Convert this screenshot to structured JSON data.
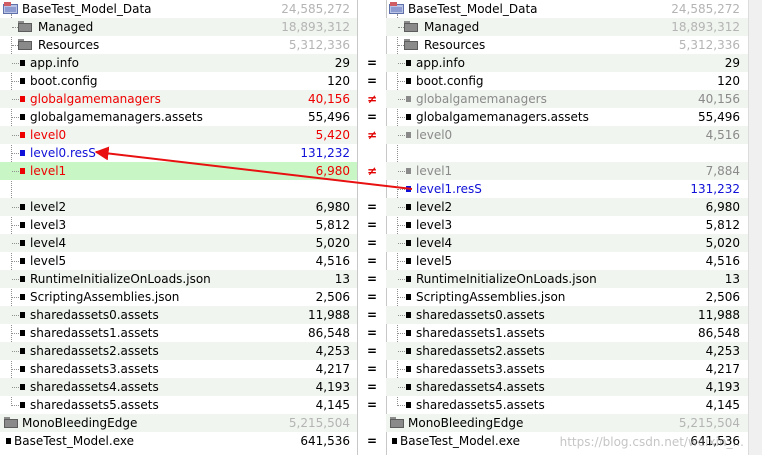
{
  "left": {
    "root": {
      "name": "BaseTest_Model_Data",
      "size": "24,585,272"
    },
    "rows": [
      {
        "name": "Managed",
        "size": "18,893,312",
        "kind": "folder",
        "status": "normal"
      },
      {
        "name": "Resources",
        "size": "5,312,336",
        "kind": "folder",
        "status": "normal"
      },
      {
        "name": "app.info",
        "size": "29",
        "kind": "file",
        "status": "normal"
      },
      {
        "name": "boot.config",
        "size": "120",
        "kind": "file",
        "status": "normal"
      },
      {
        "name": "globalgamemanagers",
        "size": "40,156",
        "kind": "file",
        "status": "red"
      },
      {
        "name": "globalgamemanagers.assets",
        "size": "55,496",
        "kind": "file",
        "status": "normal"
      },
      {
        "name": "level0",
        "size": "5,420",
        "kind": "file",
        "status": "red"
      },
      {
        "name": "level0.resS",
        "size": "131,232",
        "kind": "file",
        "status": "blue"
      },
      {
        "name": "level1",
        "size": "6,980",
        "kind": "file",
        "status": "red-green"
      },
      {
        "name": "",
        "size": "",
        "kind": "blank",
        "status": "normal"
      },
      {
        "name": "level2",
        "size": "6,980",
        "kind": "file",
        "status": "normal"
      },
      {
        "name": "level3",
        "size": "5,812",
        "kind": "file",
        "status": "normal"
      },
      {
        "name": "level4",
        "size": "5,020",
        "kind": "file",
        "status": "normal"
      },
      {
        "name": "level5",
        "size": "4,516",
        "kind": "file",
        "status": "normal"
      },
      {
        "name": "RuntimeInitializeOnLoads.json",
        "size": "13",
        "kind": "file",
        "status": "normal"
      },
      {
        "name": "ScriptingAssemblies.json",
        "size": "2,506",
        "kind": "file",
        "status": "normal"
      },
      {
        "name": "sharedassets0.assets",
        "size": "11,988",
        "kind": "file",
        "status": "normal"
      },
      {
        "name": "sharedassets1.assets",
        "size": "86,548",
        "kind": "file",
        "status": "normal"
      },
      {
        "name": "sharedassets2.assets",
        "size": "4,253",
        "kind": "file",
        "status": "normal"
      },
      {
        "name": "sharedassets3.assets",
        "size": "4,217",
        "kind": "file",
        "status": "normal"
      },
      {
        "name": "sharedassets4.assets",
        "size": "4,193",
        "kind": "file",
        "status": "normal"
      },
      {
        "name": "sharedassets5.assets",
        "size": "4,145",
        "kind": "file",
        "status": "normal"
      }
    ],
    "tail": [
      {
        "name": "MonoBleedingEdge",
        "size": "5,215,504",
        "kind": "topfolder"
      },
      {
        "name": "BaseTest_Model.exe",
        "size": "641,536",
        "kind": "topfile"
      }
    ]
  },
  "right": {
    "root": {
      "name": "BaseTest_Model_Data",
      "size": "24,585,272"
    },
    "rows": [
      {
        "name": "Managed",
        "size": "18,893,312",
        "kind": "folder",
        "status": "normal"
      },
      {
        "name": "Resources",
        "size": "5,312,336",
        "kind": "folder",
        "status": "normal"
      },
      {
        "name": "app.info",
        "size": "29",
        "kind": "file",
        "status": "normal"
      },
      {
        "name": "boot.config",
        "size": "120",
        "kind": "file",
        "status": "normal"
      },
      {
        "name": "globalgamemanagers",
        "size": "40,156",
        "kind": "file",
        "status": "gray"
      },
      {
        "name": "globalgamemanagers.assets",
        "size": "55,496",
        "kind": "file",
        "status": "normal"
      },
      {
        "name": "level0",
        "size": "4,516",
        "kind": "file",
        "status": "gray"
      },
      {
        "name": "",
        "size": "",
        "kind": "blank",
        "status": "normal"
      },
      {
        "name": "level1",
        "size": "7,884",
        "kind": "file",
        "status": "gray"
      },
      {
        "name": "level1.resS",
        "size": "131,232",
        "kind": "file",
        "status": "blue"
      },
      {
        "name": "level2",
        "size": "6,980",
        "kind": "file",
        "status": "normal"
      },
      {
        "name": "level3",
        "size": "5,812",
        "kind": "file",
        "status": "normal"
      },
      {
        "name": "level4",
        "size": "5,020",
        "kind": "file",
        "status": "normal"
      },
      {
        "name": "level5",
        "size": "4,516",
        "kind": "file",
        "status": "normal"
      },
      {
        "name": "RuntimeInitializeOnLoads.json",
        "size": "13",
        "kind": "file",
        "status": "normal"
      },
      {
        "name": "ScriptingAssemblies.json",
        "size": "2,506",
        "kind": "file",
        "status": "normal"
      },
      {
        "name": "sharedassets0.assets",
        "size": "11,988",
        "kind": "file",
        "status": "normal"
      },
      {
        "name": "sharedassets1.assets",
        "size": "86,548",
        "kind": "file",
        "status": "normal"
      },
      {
        "name": "sharedassets2.assets",
        "size": "4,253",
        "kind": "file",
        "status": "normal"
      },
      {
        "name": "sharedassets3.assets",
        "size": "4,217",
        "kind": "file",
        "status": "normal"
      },
      {
        "name": "sharedassets4.assets",
        "size": "4,193",
        "kind": "file",
        "status": "normal"
      },
      {
        "name": "sharedassets5.assets",
        "size": "4,145",
        "kind": "file",
        "status": "normal"
      }
    ],
    "tail": [
      {
        "name": "MonoBleedingEdge",
        "size": "5,215,504",
        "kind": "topfolder"
      },
      {
        "name": "BaseTest_Model.exe",
        "size": "641,536",
        "kind": "topfile"
      }
    ]
  },
  "compare_marks": [
    "",
    "",
    "",
    "=",
    "=",
    "≠",
    "=",
    "≠",
    "",
    "≠",
    "",
    "=",
    "=",
    "=",
    "=",
    "=",
    "=",
    "=",
    "=",
    "=",
    "=",
    "=",
    "=",
    "",
    "="
  ],
  "watermark": "https://blog.csdn.net/weixin_...",
  "colors": {
    "different": "#ee0000",
    "orphan": "#1010d8",
    "missing": "#8a8a8a",
    "highlight": "#c8f7c5",
    "arrow": "#e81010"
  }
}
